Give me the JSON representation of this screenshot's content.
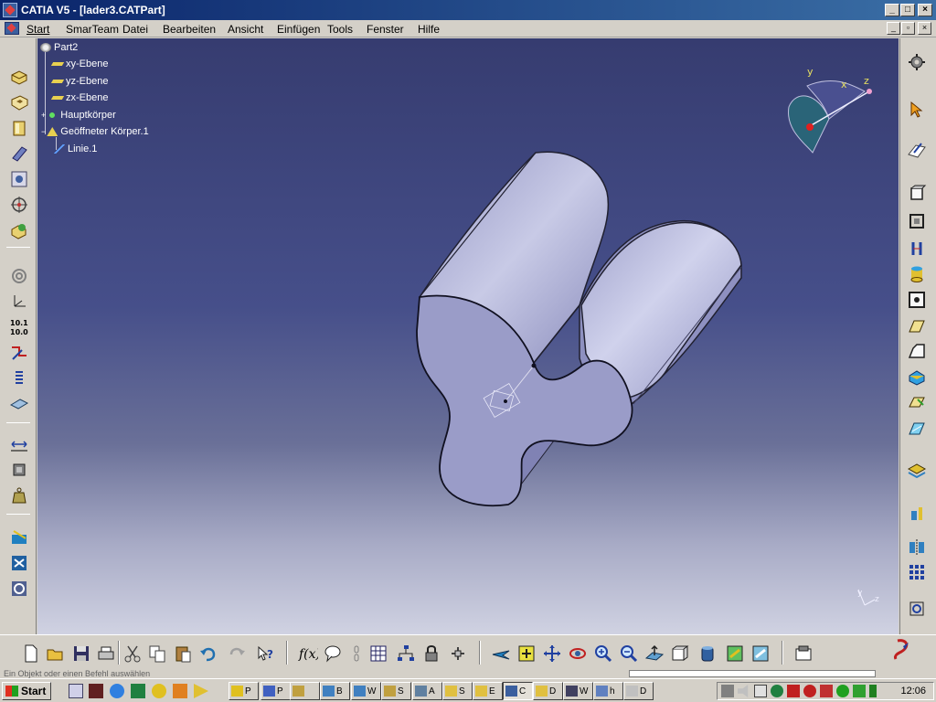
{
  "window": {
    "title": "CATIA V5 - [lader3.CATPart]",
    "minimize_label": "_",
    "maximize_label": "□",
    "close_label": "×",
    "doc_minimize_label": "_",
    "doc_restore_label": "▫",
    "doc_close_label": "×"
  },
  "menu": {
    "items": [
      {
        "label": "Start"
      },
      {
        "label": "SmarTeam"
      },
      {
        "label": "Datei"
      },
      {
        "label": "Bearbeiten"
      },
      {
        "label": "Ansicht"
      },
      {
        "label": "Einfügen"
      },
      {
        "label": "Tools"
      },
      {
        "label": "Fenster"
      },
      {
        "label": "Hilfe"
      }
    ]
  },
  "spec_tree": {
    "root": "Part2",
    "nodes": [
      {
        "label": "xy-Ebene",
        "icon": "plane-icon"
      },
      {
        "label": "yz-Ebene",
        "icon": "plane-icon"
      },
      {
        "label": "zx-Ebene",
        "icon": "plane-icon"
      },
      {
        "label": "Hauptkörper",
        "icon": "body-icon"
      },
      {
        "label": "Geöffneter Körper.1",
        "icon": "open-body-icon"
      },
      {
        "label": "Linie.1",
        "icon": "line-icon"
      }
    ]
  },
  "compass": {
    "x_label": "x",
    "y_label": "y",
    "z_label": "z"
  },
  "axis_triad": {
    "y_label": "y",
    "z_label": "z"
  },
  "status": {
    "text": "Ein Objekt oder einen Befehl auswählen"
  },
  "taskbar": {
    "start_label": "Start",
    "buttons": [
      "P",
      "P",
      "",
      "B",
      "W",
      "S",
      "A",
      "S",
      "E",
      "C",
      "D",
      "W",
      "h",
      "D"
    ],
    "active_index": 9,
    "clock": "12:06"
  },
  "colors": {
    "viewport_top": "#363c70",
    "viewport_bottom": "#d0d2e2",
    "part_face": "#9a9cc8",
    "part_side": "#b4b6dc",
    "titlebar": "#0a246a"
  }
}
